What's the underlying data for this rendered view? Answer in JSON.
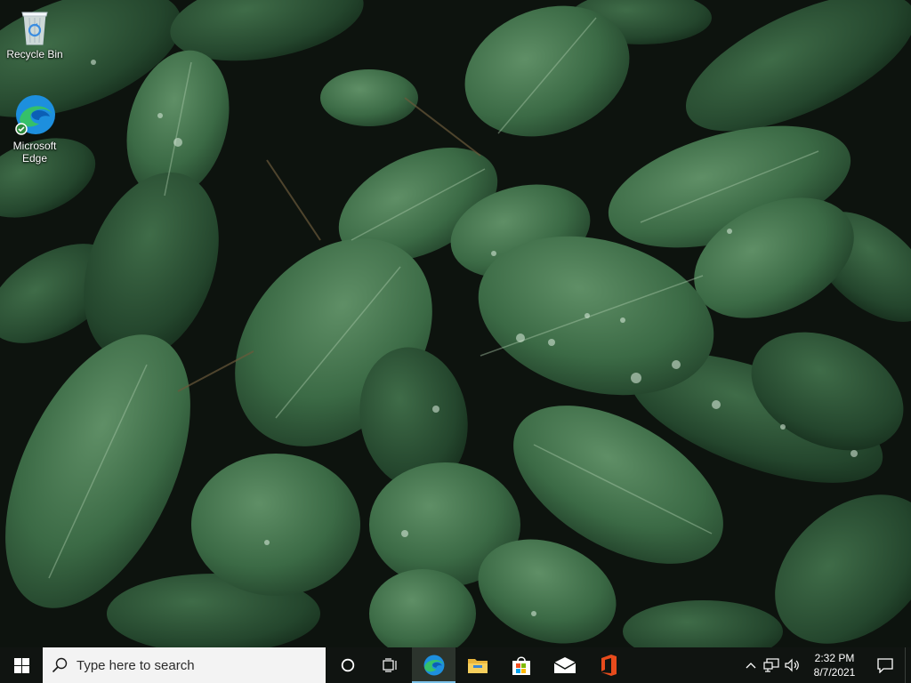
{
  "desktop": {
    "icons": [
      {
        "label": "Recycle Bin",
        "icon": "recycle-bin-icon"
      },
      {
        "label": "Microsoft\nEdge",
        "icon": "edge-icon"
      }
    ]
  },
  "taskbar": {
    "search_placeholder": "Type here to search",
    "apps": [
      {
        "name": "Microsoft Edge",
        "icon": "edge-icon",
        "active": true
      },
      {
        "name": "File Explorer",
        "icon": "folder-icon",
        "active": false
      },
      {
        "name": "Microsoft Store",
        "icon": "store-icon",
        "active": false
      },
      {
        "name": "Mail",
        "icon": "mail-icon",
        "active": false
      },
      {
        "name": "Office",
        "icon": "office-icon",
        "active": false
      }
    ],
    "clock": {
      "time": "2:32 PM",
      "date": "8/7/2021"
    }
  },
  "colors": {
    "taskbar_bg": "#101411",
    "search_bg": "#f3f3f3",
    "active_indicator": "#7bc1e8",
    "leaf_dark": "#2e5a38",
    "leaf_light": "#5b8a62"
  }
}
